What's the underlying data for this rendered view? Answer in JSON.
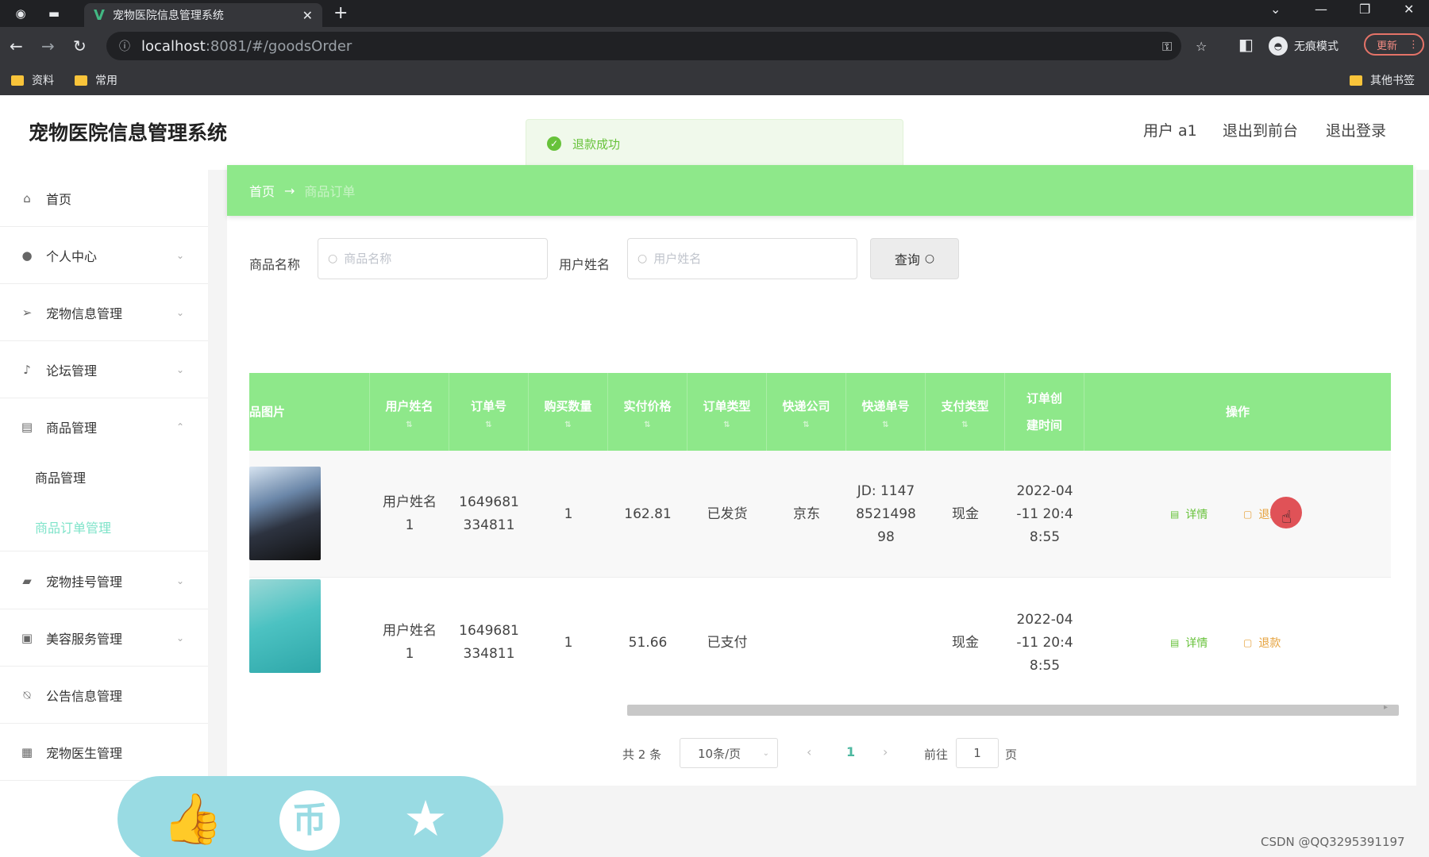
{
  "browser": {
    "tab_title": "宠物医院信息管理系统",
    "url_host": "localhost",
    "url_path": ":8081/#/goodsOrder",
    "incognito_label": "无痕模式",
    "update_label": "更新",
    "bookmarks": [
      "资料",
      "常用"
    ],
    "other_bookmarks": "其他书签"
  },
  "app": {
    "title": "宠物医院信息管理系统",
    "header_links": [
      "用户 a1",
      "退出到前台",
      "退出登录"
    ],
    "toast": "退款成功"
  },
  "sidebar": {
    "items": [
      {
        "label": "首页",
        "icon": "home-icon"
      },
      {
        "label": "个人中心",
        "icon": "user-icon"
      },
      {
        "label": "宠物信息管理",
        "icon": "send-icon"
      },
      {
        "label": "论坛管理",
        "icon": "microphone-icon"
      },
      {
        "label": "商品管理",
        "icon": "goods-icon"
      },
      {
        "label": "宠物挂号管理",
        "icon": "chat-icon"
      },
      {
        "label": "美容服务管理",
        "icon": "picture-icon"
      },
      {
        "label": "公告信息管理",
        "icon": "bell-off-icon"
      },
      {
        "label": "宠物医生管理",
        "icon": "clipboard-icon"
      }
    ],
    "submenu": [
      "商品管理",
      "商品订单管理"
    ]
  },
  "breadcrumb": {
    "home": "首页",
    "separator": "→",
    "current": "商品订单"
  },
  "search": {
    "goods_label": "商品名称",
    "goods_placeholder": "商品名称",
    "user_label": "用户姓名",
    "user_placeholder": "用户姓名",
    "query_button": "查询"
  },
  "table": {
    "columns": [
      "品图片",
      "用户姓名",
      "订单号",
      "购买数量",
      "实付价格",
      "订单类型",
      "快递公司",
      "快递单号",
      "支付类型",
      "订单创建时间",
      "操作"
    ],
    "rows": [
      {
        "user": [
          "用户姓名",
          "1"
        ],
        "order_no": [
          "1649681",
          "334811"
        ],
        "qty": "1",
        "price": "162.81",
        "order_type": "已发货",
        "courier": "京东",
        "tracking": [
          "JD: 1147",
          "8521498",
          "98"
        ],
        "pay_type": "现金",
        "created": [
          "2022-04",
          "-11 20:4",
          "8:55"
        ],
        "detail": "详情",
        "refund": "退款"
      },
      {
        "user": [
          "用户姓名",
          "1"
        ],
        "order_no": [
          "1649681",
          "334811"
        ],
        "qty": "1",
        "price": "51.66",
        "order_type": "已支付",
        "courier": "",
        "tracking": [
          "",
          "",
          ""
        ],
        "pay_type": "现金",
        "created": [
          "2022-04",
          "-11 20:4",
          "8:55"
        ],
        "detail": "详情",
        "refund": "退款"
      }
    ]
  },
  "pagination": {
    "total": "共 2 条",
    "page_size": "10条/页",
    "current": "1",
    "goto_label": "前往",
    "goto_value": "1",
    "page_suffix": "页"
  },
  "colors": {
    "accent": "#8ee88a",
    "active_menu": "#7ee3c9",
    "success": "#67c23a",
    "warning": "#e6a23c"
  },
  "watermark": "CSDN @QQ3295391197"
}
